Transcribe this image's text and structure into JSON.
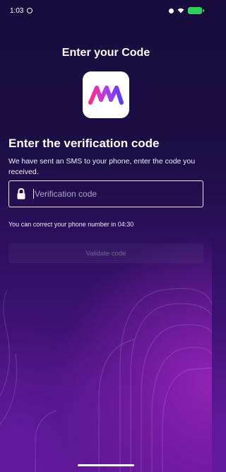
{
  "status_bar": {
    "time": "1:03",
    "icons": [
      "status-dot-icon",
      "wifi-icon",
      "signal-icon",
      "battery-icon"
    ],
    "battery_color": "#2ed158"
  },
  "screen": {
    "title": "Enter your Code",
    "logo_icon": "app-logo-icon",
    "heading": "Enter the verification code",
    "description": "We have sent an SMS to your phone, enter the code you received."
  },
  "code_field": {
    "icon": "lock-icon",
    "placeholder": "Verification code",
    "value": ""
  },
  "timer": {
    "text": "You can correct your phone number in 04:30"
  },
  "validate": {
    "label": "Validate code"
  },
  "colors": {
    "background_top": "#180c3c",
    "background_bottom": "#5a1590",
    "logo_gradient_start": "#ff2d8a",
    "logo_gradient_end": "#5b3cff"
  }
}
